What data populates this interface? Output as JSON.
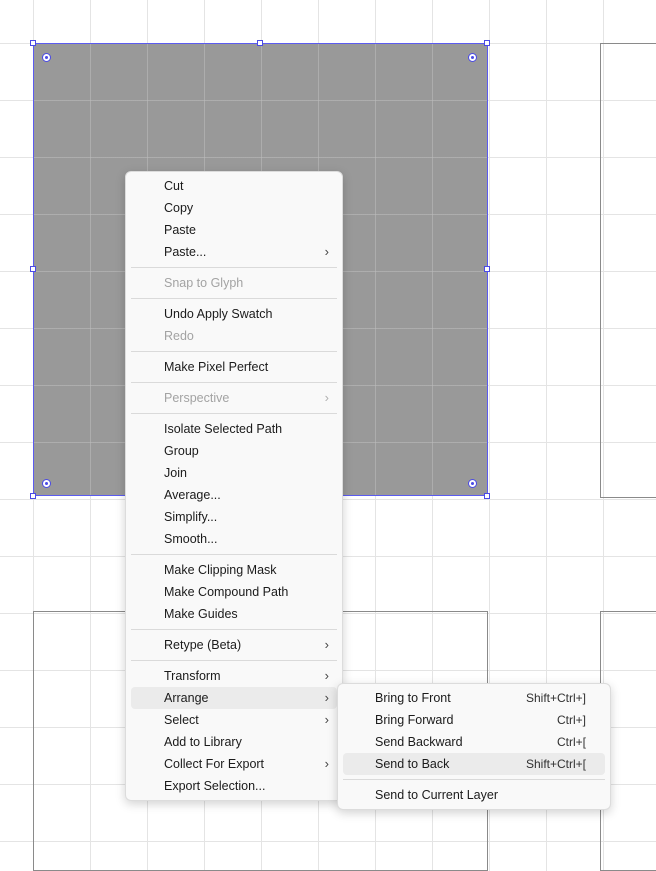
{
  "context_menu": {
    "items": [
      {
        "label": "Cut"
      },
      {
        "label": "Copy"
      },
      {
        "label": "Paste"
      },
      {
        "label": "Paste..."
      },
      {
        "label": "Snap to Glyph"
      },
      {
        "label": "Undo Apply Swatch"
      },
      {
        "label": "Redo"
      },
      {
        "label": "Make Pixel Perfect"
      },
      {
        "label": "Perspective"
      },
      {
        "label": "Isolate Selected Path"
      },
      {
        "label": "Group"
      },
      {
        "label": "Join"
      },
      {
        "label": "Average..."
      },
      {
        "label": "Simplify..."
      },
      {
        "label": "Smooth..."
      },
      {
        "label": "Make Clipping Mask"
      },
      {
        "label": "Make Compound Path"
      },
      {
        "label": "Make Guides"
      },
      {
        "label": "Retype (Beta)"
      },
      {
        "label": "Transform"
      },
      {
        "label": "Arrange"
      },
      {
        "label": "Select"
      },
      {
        "label": "Add to Library"
      },
      {
        "label": "Collect For Export"
      },
      {
        "label": "Export Selection..."
      }
    ]
  },
  "arrange_submenu": {
    "items": [
      {
        "label": "Bring to Front",
        "shortcut": "Shift+Ctrl+]"
      },
      {
        "label": "Bring Forward",
        "shortcut": "Ctrl+]"
      },
      {
        "label": "Send Backward",
        "shortcut": "Ctrl+["
      },
      {
        "label": "Send to Back",
        "shortcut": "Shift+Ctrl+["
      },
      {
        "label": "Send to Current Layer",
        "shortcut": ""
      }
    ]
  },
  "icons": {
    "submenu_arrow": "chevron-right-icon"
  },
  "colors": {
    "selection": "#4a4ae6",
    "shape_fill": "#999999",
    "menu_background": "#f9f9f9",
    "highlight": "#ebebeb",
    "disabled_text": "#a3a3a3"
  }
}
